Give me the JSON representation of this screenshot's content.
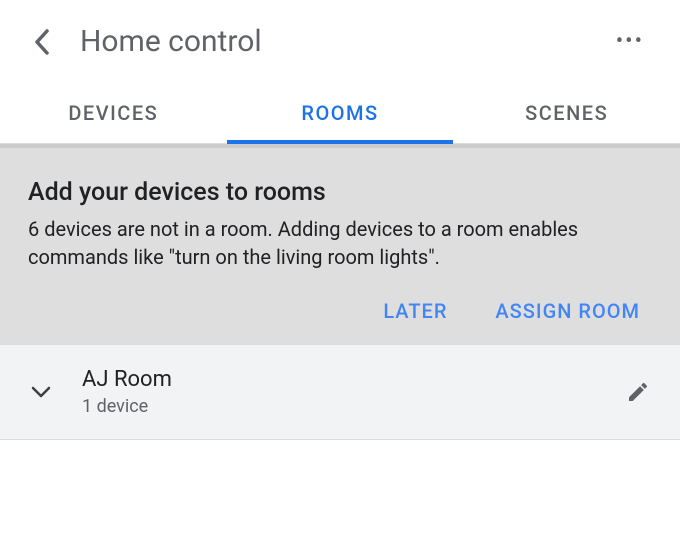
{
  "header": {
    "title": "Home control"
  },
  "tabs": {
    "devices": "DEVICES",
    "rooms": "ROOMS",
    "scenes": "SCENES"
  },
  "banner": {
    "title": "Add your devices to rooms",
    "body": "6 devices are not in a room. Adding devices to a room enables commands like \"turn on the living room lights\".",
    "later": "LATER",
    "assign": "ASSIGN ROOM"
  },
  "rooms": [
    {
      "name": "AJ Room",
      "subtitle": "1 device"
    }
  ]
}
